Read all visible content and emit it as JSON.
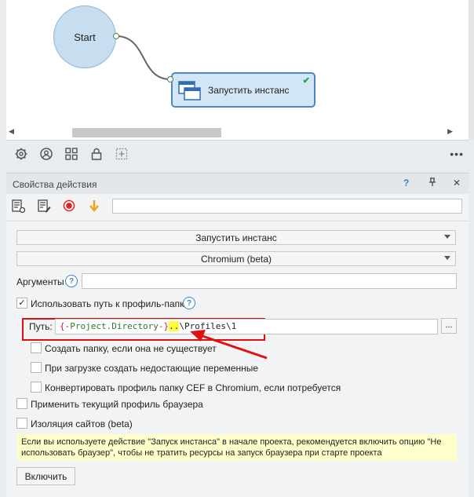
{
  "canvas": {
    "start_node_label": "Start",
    "action_node_label": "Запустить инстанс",
    "action_node_status": "✔"
  },
  "canvas_toolbar": {
    "icons": [
      "settings-icon",
      "user-icon",
      "grid-icon",
      "lock-icon",
      "add-frame-icon"
    ],
    "more_label": "•••"
  },
  "panel": {
    "title": "Свойства действия",
    "help_label": "?",
    "pin_label": "⊥",
    "close_label": "✕",
    "name_value": ""
  },
  "form": {
    "action_dropdown": "Запустить инстанс",
    "browser_dropdown": "Chromium (beta)",
    "arguments_label": "Аргументы",
    "arguments_value": "",
    "use_profile_path_label": "Использовать путь к профиль-папке",
    "use_profile_path_checked": true,
    "path_label": "Путь:",
    "path_tokens": {
      "open": "{-",
      "var": "Project.Directory",
      "close": "-}",
      "dots": "..",
      "rest": "\\Profiles\\1"
    },
    "browse_label": "...",
    "create_folder_label": "Создать папку, если она не существует",
    "create_vars_label": "При загрузке создать недостающие переменные",
    "convert_cef_label": "Конвертировать профиль папку CEF в Chromium, если потребуется",
    "apply_profile_label": "Применить текущий профиль браузера",
    "site_isolation_label": "Изоляция сайтов (beta)",
    "notice_text": "Если вы используете действие \"Запуск инстанса\" в начале проекта, рекомендуется включить опцию \"Не использовать браузер\", чтобы не тратить ресурсы на запуск браузера при старте проекта",
    "enable_button": "Включить"
  },
  "colors": {
    "annotation_red": "#e01010",
    "node_border": "#4f86c6",
    "highlight_yellow": "#ffff40"
  }
}
